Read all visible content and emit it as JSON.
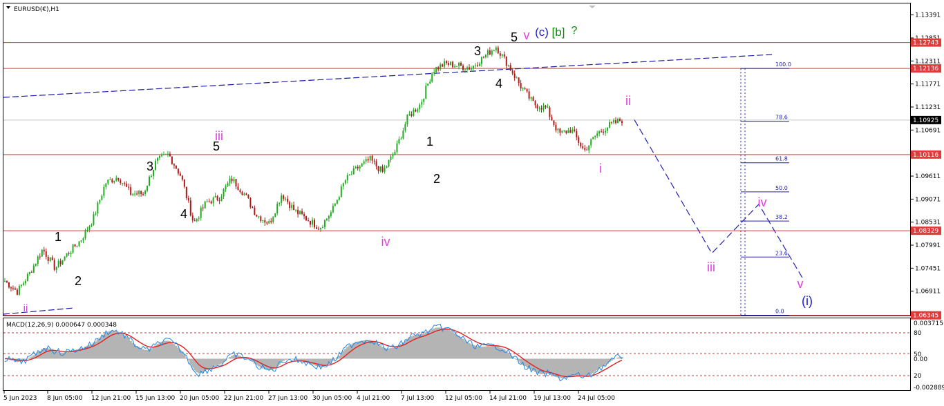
{
  "window": {
    "title": "EURUSD(€),H1",
    "menu_arrow_icon": "triangle-down-icon"
  },
  "colors": {
    "bull_candle": "#22aa22",
    "bear_candle": "#b01818",
    "hline": "#e03a3a",
    "trend": "#1a1aa8",
    "projection": "#2020b0",
    "magenta": "#e23ee2",
    "blue": "#1a1ad0",
    "green": "#0a8a0a",
    "black": "#000000",
    "macd_hist": "#b4b4b4",
    "macd_signal": "#e02020",
    "macd_main": "#1e88e5",
    "badge_red": "#e03a3a",
    "badge_black": "#000000"
  },
  "price_axis": {
    "ticks": [
      "1.13391",
      "1.12851",
      "1.12311",
      "1.11771",
      "1.11231",
      "1.10691",
      "1.10151",
      "1.09611",
      "1.09071",
      "1.08531",
      "1.07991",
      "1.07451",
      "1.06911"
    ],
    "badges": [
      {
        "label": "1.12743",
        "color": "red"
      },
      {
        "label": "1.12136",
        "color": "red"
      },
      {
        "label": "1.10925",
        "color": "black"
      },
      {
        "label": "1.10116",
        "color": "red"
      },
      {
        "label": "1.08329",
        "color": "red"
      },
      {
        "label": "1.06345",
        "color": "red"
      }
    ]
  },
  "time_axis": {
    "labels": [
      "5 Jun 2023",
      "8 Jun 05:00",
      "12 Jun 21:00",
      "15 Jun 13:00",
      "20 Jun 05:00",
      "22 Jun 21:00",
      "27 Jun 13:00",
      "30 Jun 05:00",
      "4 Jul 21:00",
      "7 Jul 13:00",
      "12 Jul 05:00",
      "14 Jul 21:00",
      "19 Jul 13:00",
      "24 Jul 05:00"
    ]
  },
  "fib_levels": [
    {
      "label": "100.0"
    },
    {
      "label": "78.6"
    },
    {
      "label": "61.8"
    },
    {
      "label": "50.0"
    },
    {
      "label": "38.2"
    },
    {
      "label": "23.6"
    },
    {
      "label": "0.0"
    }
  ],
  "wave_labels": [
    {
      "text": "ii",
      "color": "magenta"
    },
    {
      "text": "1",
      "color": "black"
    },
    {
      "text": "2",
      "color": "black"
    },
    {
      "text": "3",
      "color": "black"
    },
    {
      "text": "4",
      "color": "black"
    },
    {
      "text": "5",
      "color": "black"
    },
    {
      "text": "iii",
      "color": "magenta"
    },
    {
      "text": "iv",
      "color": "magenta"
    },
    {
      "text": "1",
      "color": "black"
    },
    {
      "text": "2",
      "color": "black"
    },
    {
      "text": "3",
      "color": "black"
    },
    {
      "text": "4",
      "color": "black"
    },
    {
      "text": "5",
      "color": "black"
    },
    {
      "text": "v",
      "color": "magenta"
    },
    {
      "text": "(c)",
      "color": "blue"
    },
    {
      "text": "[b]",
      "color": "green"
    },
    {
      "text": "?",
      "color": "green"
    },
    {
      "text": "ii",
      "color": "magenta"
    },
    {
      "text": "i",
      "color": "magenta"
    },
    {
      "text": "iii",
      "color": "magenta"
    },
    {
      "text": "iv",
      "color": "magenta"
    },
    {
      "text": "v",
      "color": "magenta"
    },
    {
      "text": "(i)",
      "color": "blue"
    }
  ],
  "macd": {
    "title": "MACD(12,26,9) 0.000647 0.000348",
    "ticks": [
      "0.003715",
      "80",
      "50",
      "0.00",
      "20",
      "-0.002889"
    ]
  },
  "chart_data": {
    "type": "line",
    "title": "EURUSD(€),H1",
    "ylim": [
      1.0634,
      1.1366
    ],
    "price_path": [
      {
        "x": "5 Jun 2023",
        "y": 1.0715
      },
      {
        "x": "6 Jun",
        "y": 1.069
      },
      {
        "x": "7 Jun",
        "y": 1.0735
      },
      {
        "x": "8 Jun 05:00",
        "y": 1.079
      },
      {
        "x": "9 Jun",
        "y": 1.0745
      },
      {
        "x": "12 Jun 21:00",
        "y": 1.078
      },
      {
        "x": "13 Jun",
        "y": 1.081
      },
      {
        "x": "14 Jun",
        "y": 1.086
      },
      {
        "x": "15 Jun 13:00",
        "y": 1.0945
      },
      {
        "x": "16 Jun",
        "y": 1.096
      },
      {
        "x": "19 Jun",
        "y": 1.092
      },
      {
        "x": "20 Jun 05:00",
        "y": 1.092
      },
      {
        "x": "21 Jun",
        "y": 1.0995
      },
      {
        "x": "21 Jun 12:00",
        "y": 1.1012
      },
      {
        "x": "22 Jun",
        "y": 1.096
      },
      {
        "x": "22 Jun 21:00",
        "y": 1.085
      },
      {
        "x": "23 Jun",
        "y": 1.09
      },
      {
        "x": "26 Jun",
        "y": 1.091
      },
      {
        "x": "27 Jun 13:00",
        "y": 1.0955
      },
      {
        "x": "28 Jun",
        "y": 1.092
      },
      {
        "x": "29 Jun",
        "y": 1.087
      },
      {
        "x": "30 Jun 05:00",
        "y": 1.085
      },
      {
        "x": "3 Jul",
        "y": 1.092
      },
      {
        "x": "4 Jul",
        "y": 1.088
      },
      {
        "x": "4 Jul 21:00",
        "y": 1.086
      },
      {
        "x": "5 Jul",
        "y": 1.084
      },
      {
        "x": "6 Jul",
        "y": 1.088
      },
      {
        "x": "6 Jul 18:00",
        "y": 1.095
      },
      {
        "x": "7 Jul 13:00",
        "y": 1.098
      },
      {
        "x": "10 Jul",
        "y": 1.1
      },
      {
        "x": "10 Jul 12:00",
        "y": 1.097
      },
      {
        "x": "11 Jul",
        "y": 1.102
      },
      {
        "x": "11 Jul 12:00",
        "y": 1.11
      },
      {
        "x": "12 Jul 05:00",
        "y": 1.113
      },
      {
        "x": "13 Jul",
        "y": 1.121
      },
      {
        "x": "13 Jul 12:00",
        "y": 1.1225
      },
      {
        "x": "14 Jul",
        "y": 1.122
      },
      {
        "x": "14 Jul 21:00",
        "y": 1.1215
      },
      {
        "x": "17 Jul",
        "y": 1.124
      },
      {
        "x": "18 Jul",
        "y": 1.1265
      },
      {
        "x": "18 Jul 12:00",
        "y": 1.122
      },
      {
        "x": "19 Jul 13:00",
        "y": 1.117
      },
      {
        "x": "20 Jul",
        "y": 1.113
      },
      {
        "x": "21 Jul",
        "y": 1.112
      },
      {
        "x": "24 Jul",
        "y": 1.106
      },
      {
        "x": "24 Jul 05:00",
        "y": 1.107
      },
      {
        "x": "25 Jul",
        "y": 1.102
      },
      {
        "x": "25 Jul 12:00",
        "y": 1.106
      },
      {
        "x": "26 Jul",
        "y": 1.108
      },
      {
        "x": "26 Jul 12:00",
        "y": 1.1093
      }
    ],
    "horizontal_levels": [
      1.12743,
      1.12136,
      1.10116,
      1.08329,
      1.06345
    ],
    "current_price": 1.10925,
    "fib_retracement": {
      "from": 1.12136,
      "to": 1.06345,
      "levels": [
        100.0,
        78.6,
        61.8,
        50.0,
        38.2,
        23.6,
        0.0
      ]
    },
    "projection_path": [
      {
        "label": "ii",
        "y": 1.1093
      },
      {
        "label": "iii",
        "y": 1.078
      },
      {
        "label": "iv",
        "y": 1.0895
      },
      {
        "label": "v",
        "y": 1.072
      }
    ],
    "macd": {
      "params": "12,26,9",
      "main": 0.000647,
      "signal": 0.000348,
      "ylim": [
        -0.002889,
        0.003715
      ]
    }
  }
}
